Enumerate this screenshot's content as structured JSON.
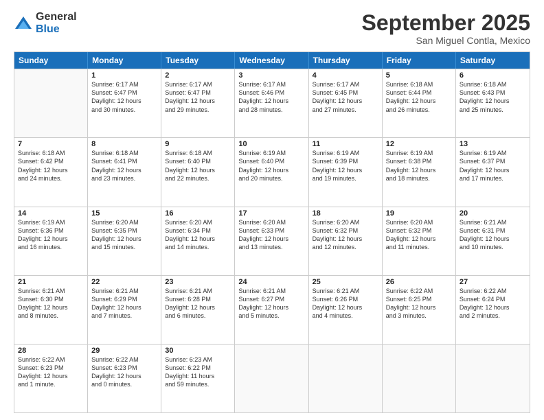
{
  "logo": {
    "general": "General",
    "blue": "Blue"
  },
  "header": {
    "month": "September 2025",
    "location": "San Miguel Contla, Mexico"
  },
  "weekdays": [
    "Sunday",
    "Monday",
    "Tuesday",
    "Wednesday",
    "Thursday",
    "Friday",
    "Saturday"
  ],
  "weeks": [
    [
      {
        "day": "",
        "info": ""
      },
      {
        "day": "1",
        "info": "Sunrise: 6:17 AM\nSunset: 6:47 PM\nDaylight: 12 hours\nand 30 minutes."
      },
      {
        "day": "2",
        "info": "Sunrise: 6:17 AM\nSunset: 6:47 PM\nDaylight: 12 hours\nand 29 minutes."
      },
      {
        "day": "3",
        "info": "Sunrise: 6:17 AM\nSunset: 6:46 PM\nDaylight: 12 hours\nand 28 minutes."
      },
      {
        "day": "4",
        "info": "Sunrise: 6:17 AM\nSunset: 6:45 PM\nDaylight: 12 hours\nand 27 minutes."
      },
      {
        "day": "5",
        "info": "Sunrise: 6:18 AM\nSunset: 6:44 PM\nDaylight: 12 hours\nand 26 minutes."
      },
      {
        "day": "6",
        "info": "Sunrise: 6:18 AM\nSunset: 6:43 PM\nDaylight: 12 hours\nand 25 minutes."
      }
    ],
    [
      {
        "day": "7",
        "info": "Sunrise: 6:18 AM\nSunset: 6:42 PM\nDaylight: 12 hours\nand 24 minutes."
      },
      {
        "day": "8",
        "info": "Sunrise: 6:18 AM\nSunset: 6:41 PM\nDaylight: 12 hours\nand 23 minutes."
      },
      {
        "day": "9",
        "info": "Sunrise: 6:18 AM\nSunset: 6:40 PM\nDaylight: 12 hours\nand 22 minutes."
      },
      {
        "day": "10",
        "info": "Sunrise: 6:19 AM\nSunset: 6:40 PM\nDaylight: 12 hours\nand 20 minutes."
      },
      {
        "day": "11",
        "info": "Sunrise: 6:19 AM\nSunset: 6:39 PM\nDaylight: 12 hours\nand 19 minutes."
      },
      {
        "day": "12",
        "info": "Sunrise: 6:19 AM\nSunset: 6:38 PM\nDaylight: 12 hours\nand 18 minutes."
      },
      {
        "day": "13",
        "info": "Sunrise: 6:19 AM\nSunset: 6:37 PM\nDaylight: 12 hours\nand 17 minutes."
      }
    ],
    [
      {
        "day": "14",
        "info": "Sunrise: 6:19 AM\nSunset: 6:36 PM\nDaylight: 12 hours\nand 16 minutes."
      },
      {
        "day": "15",
        "info": "Sunrise: 6:20 AM\nSunset: 6:35 PM\nDaylight: 12 hours\nand 15 minutes."
      },
      {
        "day": "16",
        "info": "Sunrise: 6:20 AM\nSunset: 6:34 PM\nDaylight: 12 hours\nand 14 minutes."
      },
      {
        "day": "17",
        "info": "Sunrise: 6:20 AM\nSunset: 6:33 PM\nDaylight: 12 hours\nand 13 minutes."
      },
      {
        "day": "18",
        "info": "Sunrise: 6:20 AM\nSunset: 6:32 PM\nDaylight: 12 hours\nand 12 minutes."
      },
      {
        "day": "19",
        "info": "Sunrise: 6:20 AM\nSunset: 6:32 PM\nDaylight: 12 hours\nand 11 minutes."
      },
      {
        "day": "20",
        "info": "Sunrise: 6:21 AM\nSunset: 6:31 PM\nDaylight: 12 hours\nand 10 minutes."
      }
    ],
    [
      {
        "day": "21",
        "info": "Sunrise: 6:21 AM\nSunset: 6:30 PM\nDaylight: 12 hours\nand 8 minutes."
      },
      {
        "day": "22",
        "info": "Sunrise: 6:21 AM\nSunset: 6:29 PM\nDaylight: 12 hours\nand 7 minutes."
      },
      {
        "day": "23",
        "info": "Sunrise: 6:21 AM\nSunset: 6:28 PM\nDaylight: 12 hours\nand 6 minutes."
      },
      {
        "day": "24",
        "info": "Sunrise: 6:21 AM\nSunset: 6:27 PM\nDaylight: 12 hours\nand 5 minutes."
      },
      {
        "day": "25",
        "info": "Sunrise: 6:21 AM\nSunset: 6:26 PM\nDaylight: 12 hours\nand 4 minutes."
      },
      {
        "day": "26",
        "info": "Sunrise: 6:22 AM\nSunset: 6:25 PM\nDaylight: 12 hours\nand 3 minutes."
      },
      {
        "day": "27",
        "info": "Sunrise: 6:22 AM\nSunset: 6:24 PM\nDaylight: 12 hours\nand 2 minutes."
      }
    ],
    [
      {
        "day": "28",
        "info": "Sunrise: 6:22 AM\nSunset: 6:23 PM\nDaylight: 12 hours\nand 1 minute."
      },
      {
        "day": "29",
        "info": "Sunrise: 6:22 AM\nSunset: 6:23 PM\nDaylight: 12 hours\nand 0 minutes."
      },
      {
        "day": "30",
        "info": "Sunrise: 6:23 AM\nSunset: 6:22 PM\nDaylight: 11 hours\nand 59 minutes."
      },
      {
        "day": "",
        "info": ""
      },
      {
        "day": "",
        "info": ""
      },
      {
        "day": "",
        "info": ""
      },
      {
        "day": "",
        "info": ""
      }
    ]
  ]
}
